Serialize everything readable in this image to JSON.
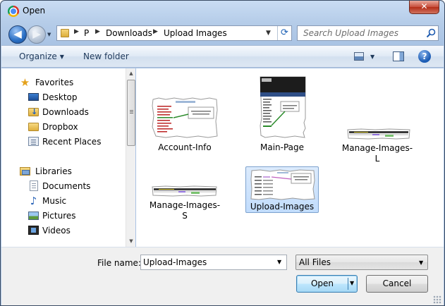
{
  "window": {
    "title": "Open",
    "close_label": "✕"
  },
  "navigation": {
    "back_label": "◀",
    "forward_label": "▶",
    "recent_label": "▼"
  },
  "address": {
    "crumbs": [
      "P",
      "Downloads",
      "Upload Images"
    ],
    "separator": "▶",
    "dropdown_label": "▼",
    "refresh_label": "⟳"
  },
  "search": {
    "placeholder": "Search Upload Images"
  },
  "commandbar": {
    "organize_label": "Organize",
    "organize_caret": "▼",
    "new_folder_label": "New folder",
    "views_caret": "▼",
    "help_label": "?"
  },
  "sidebar": {
    "favorites": {
      "label": "Favorites",
      "items": [
        {
          "label": "Desktop",
          "icon": "desktop-icon"
        },
        {
          "label": "Downloads",
          "icon": "downloads-folder-icon"
        },
        {
          "label": "Dropbox",
          "icon": "folder-icon"
        },
        {
          "label": "Recent Places",
          "icon": "recent-places-icon"
        }
      ]
    },
    "libraries": {
      "label": "Libraries",
      "items": [
        {
          "label": "Documents",
          "icon": "documents-icon"
        },
        {
          "label": "Music",
          "icon": "music-icon"
        },
        {
          "label": "Pictures",
          "icon": "pictures-icon"
        },
        {
          "label": "Videos",
          "icon": "videos-icon"
        }
      ]
    },
    "scroll_up": "▲",
    "scroll_down": "▼"
  },
  "files": [
    {
      "name": "Account-Info",
      "selected": false
    },
    {
      "name": "Main-Page",
      "selected": false
    },
    {
      "name": "Manage-Images-L",
      "selected": false
    },
    {
      "name": "Manage-Images-S",
      "selected": false
    },
    {
      "name": "Upload-Images",
      "selected": true
    }
  ],
  "footer": {
    "file_name_label": "File name:",
    "file_name_value": "Upload-Images",
    "file_name_caret": "▼",
    "file_type_value": "All Files",
    "file_type_caret": "▼",
    "open_label": "Open",
    "open_caret": "▼",
    "cancel_label": "Cancel"
  }
}
